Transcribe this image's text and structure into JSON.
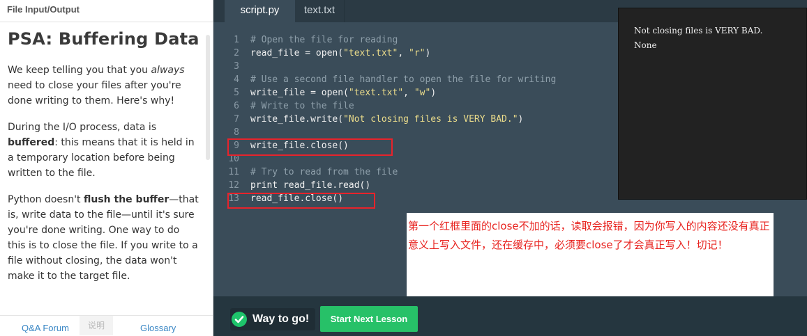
{
  "left_panel": {
    "header": "File Input/Output",
    "title": "PSA: Buffering Data",
    "p1": {
      "a": "We keep telling you that you ",
      "em": "always",
      "b": " need to close your files after you're done writing to them. Here's why!"
    },
    "p2": {
      "a": "During the I/O process, data is ",
      "strong": "buffered",
      "b": ": this means that it is held in a temporary location before being written to the file."
    },
    "p3": {
      "a": "Python doesn't ",
      "strong": "flush the buffer",
      "b": "—that is, write data to the file—until it's sure you're done writing. One way to do this is to close the file. If you write to a file without closing, the data won't make it to the target file."
    },
    "footer": {
      "qa": "Q&A Forum",
      "mid": "说明",
      "glossary": "Glossary"
    }
  },
  "tabs": [
    "script.py",
    "text.txt"
  ],
  "code": {
    "lines": [
      {
        "n": "1",
        "parts": [
          {
            "t": "# Open the file for reading",
            "c": "comment"
          }
        ]
      },
      {
        "n": "2",
        "parts": [
          {
            "t": "read_file = open(",
            "c": "plain"
          },
          {
            "t": "\"text.txt\"",
            "c": "string"
          },
          {
            "t": ", ",
            "c": "plain"
          },
          {
            "t": "\"r\"",
            "c": "string"
          },
          {
            "t": ")",
            "c": "plain"
          }
        ]
      },
      {
        "n": "3",
        "parts": []
      },
      {
        "n": "4",
        "parts": [
          {
            "t": "# Use a second file handler to open the file for writing",
            "c": "comment"
          }
        ]
      },
      {
        "n": "5",
        "parts": [
          {
            "t": "write_file = open(",
            "c": "plain"
          },
          {
            "t": "\"text.txt\"",
            "c": "string"
          },
          {
            "t": ", ",
            "c": "plain"
          },
          {
            "t": "\"w\"",
            "c": "string"
          },
          {
            "t": ")",
            "c": "plain"
          }
        ]
      },
      {
        "n": "6",
        "parts": [
          {
            "t": "# Write to the file",
            "c": "comment"
          }
        ]
      },
      {
        "n": "7",
        "parts": [
          {
            "t": "write_file.write(",
            "c": "plain"
          },
          {
            "t": "\"Not closing files is VERY BAD.\"",
            "c": "string"
          },
          {
            "t": ")",
            "c": "plain"
          }
        ]
      },
      {
        "n": "8",
        "parts": []
      },
      {
        "n": "9",
        "parts": [
          {
            "t": "write_file.close()",
            "c": "plain"
          }
        ]
      },
      {
        "n": "10",
        "parts": []
      },
      {
        "n": "11",
        "parts": [
          {
            "t": "# Try to read from the file",
            "c": "comment"
          }
        ]
      },
      {
        "n": "12",
        "parts": [
          {
            "t": "print read_file.read()",
            "c": "plain"
          }
        ]
      },
      {
        "n": "13",
        "parts": [
          {
            "t": "read_file.close()",
            "c": "plain"
          }
        ],
        "active": true
      }
    ]
  },
  "output": {
    "lines": [
      "Not closing files is VERY BAD.",
      "None"
    ]
  },
  "annotation": "第一个红框里面的close不加的话，读取会报错，因为你写入的内容还没有真正意义上写入文件，还在缓存中，必须要close了才会真正写入！切记！",
  "bottom": {
    "status": "Way to go!",
    "next_button": "Start Next Lesson"
  },
  "colors": {
    "accent_green": "#27c168",
    "highlight_red": "#e8232b",
    "editor_bg": "#3a4c59"
  }
}
